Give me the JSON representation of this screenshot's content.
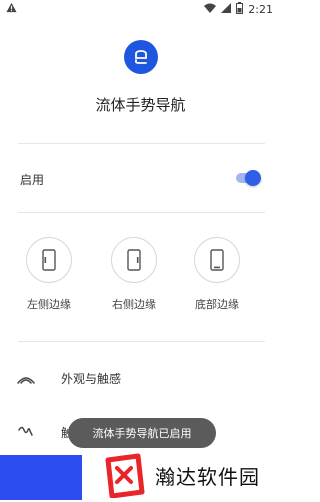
{
  "status_bar": {
    "time": "2:21",
    "left_icon": "warning-icon",
    "right_icons": [
      "wifi-icon",
      "cellular-icon",
      "battery-icon"
    ]
  },
  "header": {
    "app_icon": "gesture-logo-icon",
    "title": "流体手势导航"
  },
  "enable": {
    "label": "启用",
    "enabled": true
  },
  "edges": [
    {
      "icon": "phone-left-edge-icon",
      "label": "左侧边缘"
    },
    {
      "icon": "phone-right-edge-icon",
      "label": "右侧边缘"
    },
    {
      "icon": "phone-bottom-edge-icon",
      "label": "底部边缘"
    }
  ],
  "menu": [
    {
      "icon": "wifi-arcs-icon",
      "label": "外观与触感"
    },
    {
      "icon": "squiggle-icon",
      "label": "触发"
    }
  ],
  "toast": "流体手势导航已启用",
  "watermark": {
    "brand_text": "瀚达软件园"
  },
  "colors": {
    "accent": "#1f56e0",
    "toggle_thumb": "#2e5fe6",
    "toggle_track": "#9fb6ee",
    "watermark_blue": "#2c4ef0",
    "logo_red": "#e8262a"
  }
}
